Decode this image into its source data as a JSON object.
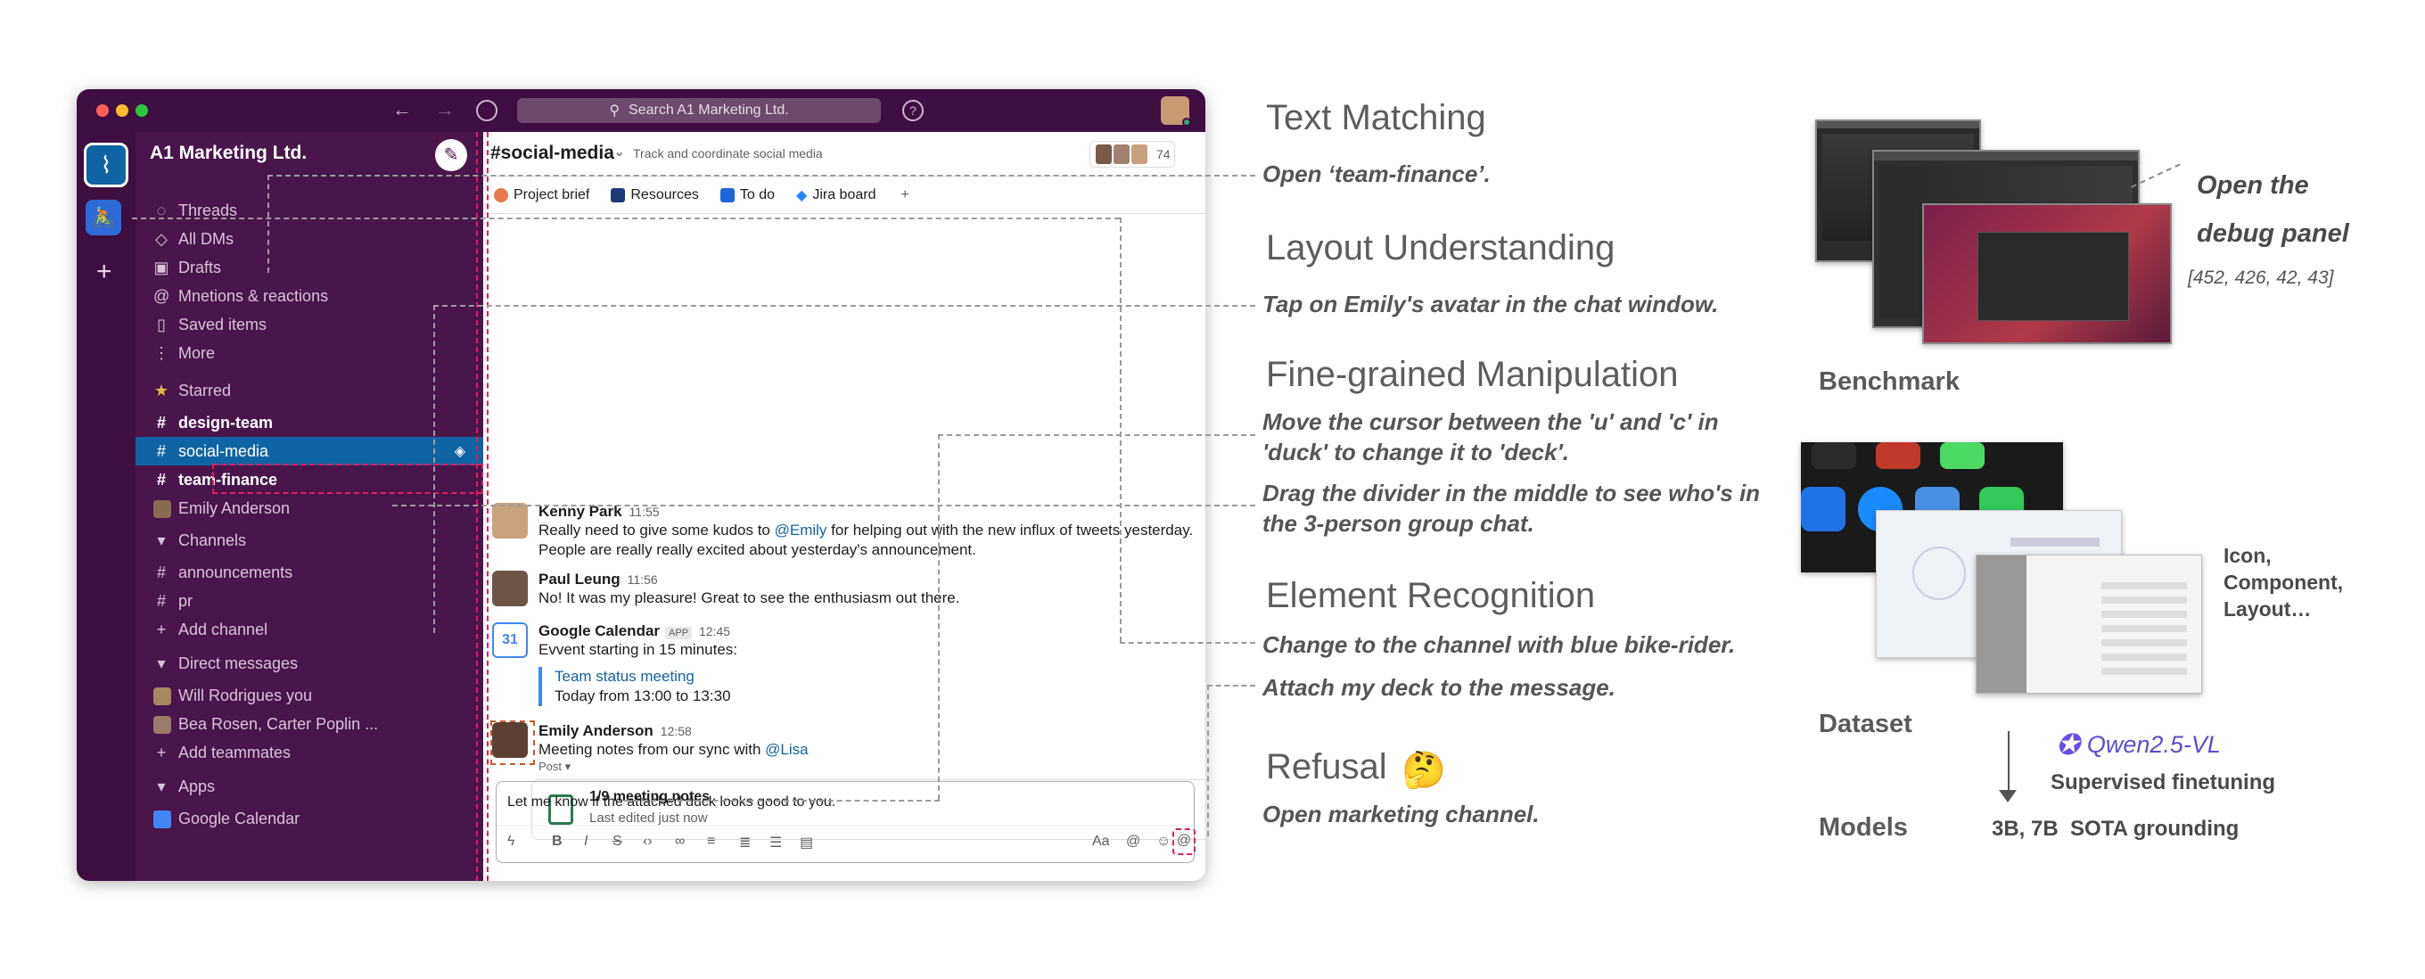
{
  "window": {
    "search_placeholder": "Search A1 Marketing Ltd.",
    "workspace": "A1 Marketing Ltd.",
    "sidebar": {
      "nav": [
        {
          "icon": "threads-icon",
          "label": "Threads"
        },
        {
          "icon": "dms-icon",
          "label": "All DMs"
        },
        {
          "icon": "drafts-icon",
          "label": "Drafts"
        },
        {
          "icon": "mention-icon",
          "label": "Mnetions & reactions"
        },
        {
          "icon": "bookmark-icon",
          "label": "Saved items"
        },
        {
          "icon": "more-icon",
          "label": "More"
        }
      ],
      "starred_header": "Starred",
      "starred": [
        "design-team",
        "social-media",
        "team-finance"
      ],
      "starred_dm": "Emily Anderson",
      "channels_header": "Channels",
      "channels": [
        "announcements",
        "pr"
      ],
      "add_channel": "Add channel",
      "dm_header": "Direct messages",
      "dms": [
        "Will Rodrigues you",
        "Bea Rosen, Carter Poplin ..."
      ],
      "add_teammates": "Add teammates",
      "apps_header": "Apps",
      "apps": [
        "Google Calendar"
      ]
    },
    "channel": {
      "name": "#social-media",
      "topic": "Track and coordinate social media",
      "member_count": "74",
      "tabs": [
        "Project brief",
        "Resources",
        "To do",
        "Jira board",
        "+"
      ]
    },
    "messages": [
      {
        "name": "Kenny Park",
        "time": "11:55",
        "text_pre": "Really need to give some kudos to ",
        "mention": "@Emily",
        "text_post": " for helping out with the new influx of tweets yesterday.",
        "line2": "People are really really excited about yesterday's announcement."
      },
      {
        "name": "Paul Leung",
        "time": "11:56",
        "text": "No! It was my pleasure! Great to see the enthusiasm out there."
      },
      {
        "name": "Google Calendar",
        "badge": "APP",
        "time": "12:45",
        "text": "Evvent starting in 15 minutes:",
        "event_title": "Team status meeting",
        "event_time": "Today from 13:00 to 13:30",
        "cal_day": "31"
      },
      {
        "name": "Emily Anderson",
        "time": "12:58",
        "text_pre": "Meeting notes from our sync with ",
        "mention": "@Lisa",
        "post_label": "Post",
        "file_title": "1/9 meeting notes",
        "file_sub": "Last edited just now"
      }
    ],
    "composer": {
      "text": "Let me know if the attached duck looks good to you."
    }
  },
  "tasks": [
    {
      "heading": "Text Matching",
      "instruction": "Open ‘team-finance’."
    },
    {
      "heading": "Layout Understanding",
      "instruction": "Tap on Emily's avatar in the chat window."
    },
    {
      "heading": "Fine-grained Manipulation",
      "instruction": "Move the cursor between the 'u' and 'c' in 'duck' to change it to 'deck'.",
      "instruction2": "Drag the divider in the middle to see who's in the 3-person group chat."
    },
    {
      "heading": "Element Recognition",
      "instruction": "Change to the channel with blue bike-rider.",
      "instruction2": "Attach my deck to the message."
    },
    {
      "heading": "Refusal",
      "emoji": "🤔",
      "instruction": "Open marketing channel."
    }
  ],
  "right": {
    "benchmark_label": "Benchmark",
    "bench_note_1": "Open the",
    "bench_note_2": "debug panel",
    "bench_coords": "[452, 426, 42, 43]",
    "dataset_label": "Dataset",
    "dataset_note": "Icon,\nComponent,\nLayout…",
    "models_label": "Models",
    "model_name": "Qwen2.5-VL",
    "sft": "Supervised finetuning",
    "models_note": "3B, 7B  SOTA grounding"
  },
  "colors": {
    "aubergine": "#4a154b",
    "active": "#1164a3",
    "accent_red": "#e01e5a",
    "link": "#1264a3"
  }
}
